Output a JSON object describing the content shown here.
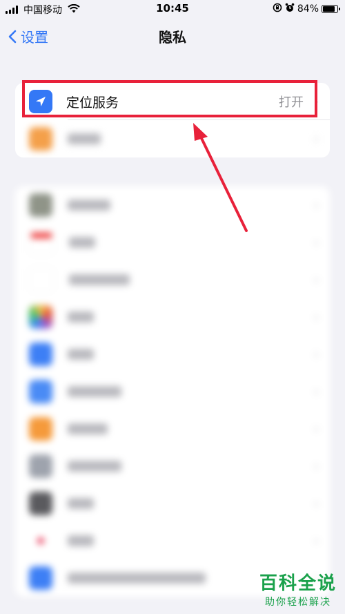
{
  "status_bar": {
    "carrier": "中国移动",
    "time": "10:45",
    "battery": "84%"
  },
  "nav": {
    "back_label": "设置",
    "title": "隐私"
  },
  "location_row": {
    "label": "定位服务",
    "value": "打开",
    "icon": "location-arrow-icon",
    "icon_color": "#3478f6"
  },
  "colors": {
    "accent": "#3478f6",
    "highlight": "#e8213a",
    "watermark": "#1aa14b"
  },
  "watermark": {
    "main": "百科全说",
    "sub": "助你轻松解决"
  }
}
